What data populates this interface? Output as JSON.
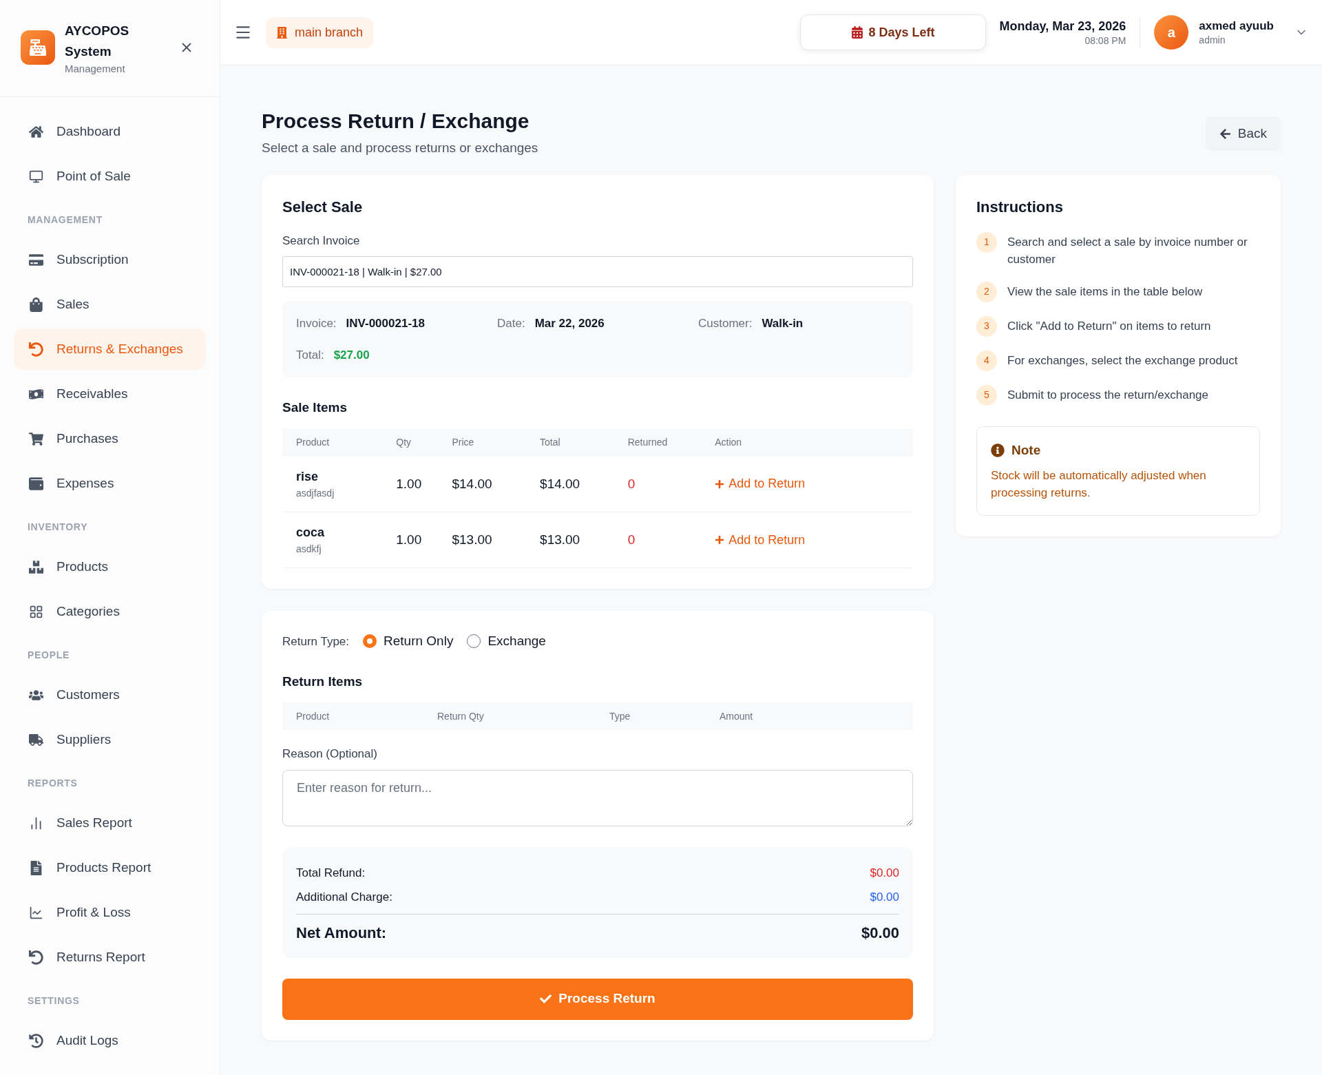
{
  "sidebar": {
    "brand": {
      "name": "AYCOPOS System",
      "subtitle": "Management"
    },
    "sections": [
      {
        "items": [
          {
            "label": "Dashboard",
            "selected": false
          },
          {
            "label": "Point of Sale",
            "selected": false
          }
        ]
      },
      {
        "label": "MANAGEMENT",
        "items": [
          {
            "label": "Subscription",
            "selected": false
          },
          {
            "label": "Sales",
            "selected": false
          },
          {
            "label": "Returns & Exchanges",
            "selected": true
          },
          {
            "label": "Receivables",
            "selected": false
          },
          {
            "label": "Purchases",
            "selected": false
          },
          {
            "label": "Expenses",
            "selected": false
          }
        ]
      },
      {
        "label": "INVENTORY",
        "items": [
          {
            "label": "Products",
            "selected": false
          },
          {
            "label": "Categories",
            "selected": false
          }
        ]
      },
      {
        "label": "PEOPLE",
        "items": [
          {
            "label": "Customers",
            "selected": false
          },
          {
            "label": "Suppliers",
            "selected": false
          }
        ]
      },
      {
        "label": "REPORTS",
        "items": [
          {
            "label": "Sales Report",
            "selected": false
          },
          {
            "label": "Products Report",
            "selected": false
          },
          {
            "label": "Profit & Loss",
            "selected": false
          },
          {
            "label": "Returns Report",
            "selected": false
          }
        ]
      },
      {
        "label": "SETTINGS",
        "items": [
          {
            "label": "Audit Logs",
            "selected": false
          }
        ]
      }
    ]
  },
  "header": {
    "branch": "main branch",
    "trial": "8 Days Left",
    "date": "Monday, Mar 23, 2026",
    "time": "08:08 PM",
    "user": {
      "initial": "a",
      "name": "axmed ayuub",
      "role": "admin"
    }
  },
  "page": {
    "title": "Process Return / Exchange",
    "subtitle": "Select a sale and process returns or exchanges",
    "back": "Back"
  },
  "select_sale": {
    "title": "Select Sale",
    "search_label": "Search Invoice",
    "search_value": "INV-000021-18 | Walk-in | $27.00",
    "summary": [
      {
        "label": "Invoice:",
        "value": "INV-000021-18",
        "kind": "plain"
      },
      {
        "label": "Date:",
        "value": "Mar 22, 2026",
        "kind": "plain"
      },
      {
        "label": "Customer:",
        "value": "Walk-in",
        "kind": "plain"
      },
      {
        "label": "Total:",
        "value": "$27.00",
        "kind": "money"
      }
    ],
    "items_title": "Sale Items",
    "table": {
      "columns": [
        "Product",
        "Qty",
        "Price",
        "Total",
        "Returned",
        "Action"
      ],
      "rows": [
        {
          "product": "rise",
          "sku": "asdjfasdj",
          "qty": "1.00",
          "price": "$14.00",
          "total": "$14.00",
          "returned": "0",
          "action": "Add to Return"
        },
        {
          "product": "coca",
          "sku": "asdkfj",
          "qty": "1.00",
          "price": "$13.00",
          "total": "$13.00",
          "returned": "0",
          "action": "Add to Return"
        }
      ]
    }
  },
  "return_form": {
    "type_label": "Return Type:",
    "options": [
      {
        "label": "Return Only",
        "selected": true
      },
      {
        "label": "Exchange",
        "selected": false
      }
    ],
    "items_title": "Return Items",
    "columns": [
      "Product",
      "Return Qty",
      "Type",
      "Amount"
    ],
    "reason_label": "Reason (Optional)",
    "reason_placeholder": "Enter reason for return...",
    "totals": [
      {
        "label": "Total Refund:",
        "value": "$0.00",
        "color": "#dc2626"
      },
      {
        "label": "Additional Charge:",
        "value": "$0.00",
        "color": "#2563eb"
      }
    ],
    "net_label": "Net Amount:",
    "net_value": "$0.00",
    "submit": "Process Return"
  },
  "instructions": {
    "title": "Instructions",
    "steps": [
      {
        "number": "1",
        "text": "Search and select a sale by invoice number or customer"
      },
      {
        "number": "2",
        "text": "View the sale items in the table below"
      },
      {
        "number": "3",
        "text": "Click \"Add to Return\" on items to return"
      },
      {
        "number": "4",
        "text": "For exchanges, select the exchange product"
      },
      {
        "number": "5",
        "text": "Submit to process the return/exchange"
      }
    ],
    "note": {
      "title": "Note",
      "text": "Stock will be automatically adjusted when processing returns."
    }
  }
}
